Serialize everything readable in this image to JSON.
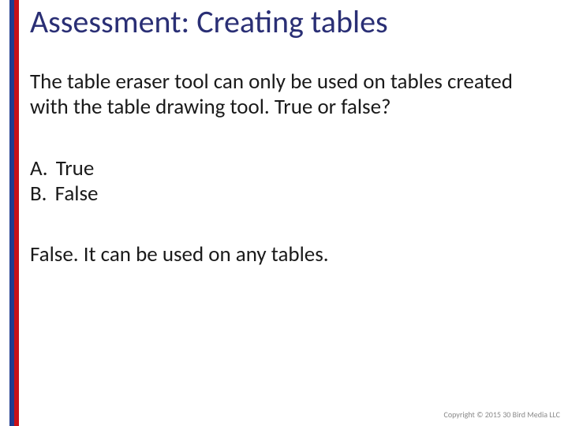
{
  "title": "Assessment: Creating tables",
  "question": "The table eraser tool can only be used on tables created with the table drawing tool. True or false?",
  "options": [
    {
      "label": "A.",
      "text": "True"
    },
    {
      "label": "B.",
      "text": "False"
    }
  ],
  "answer": "False. It can be used on any tables.",
  "footer": "Copyright © 2015 30 Bird Media LLC",
  "accent": {
    "blue": "#203b8f",
    "red": "#c81018"
  }
}
